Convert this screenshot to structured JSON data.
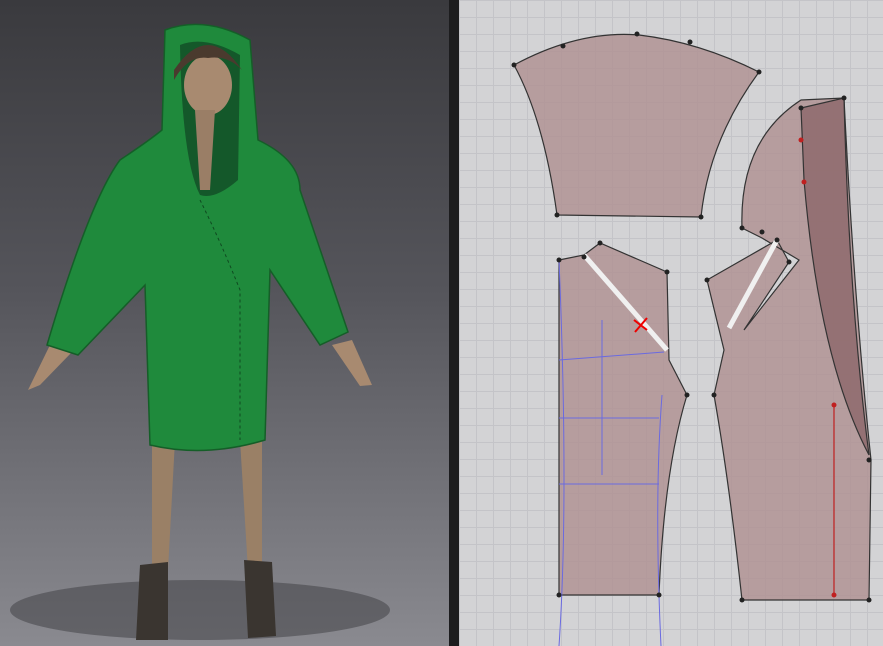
{
  "colors": {
    "garment": "#1f8a3c",
    "pattern_fill": "#b09394",
    "viewport_bg": "#4a4a50",
    "pattern_bg": "#d3d3d5",
    "seam_red": "#c02020",
    "grainline_blue": "#6a6ae0"
  }
}
